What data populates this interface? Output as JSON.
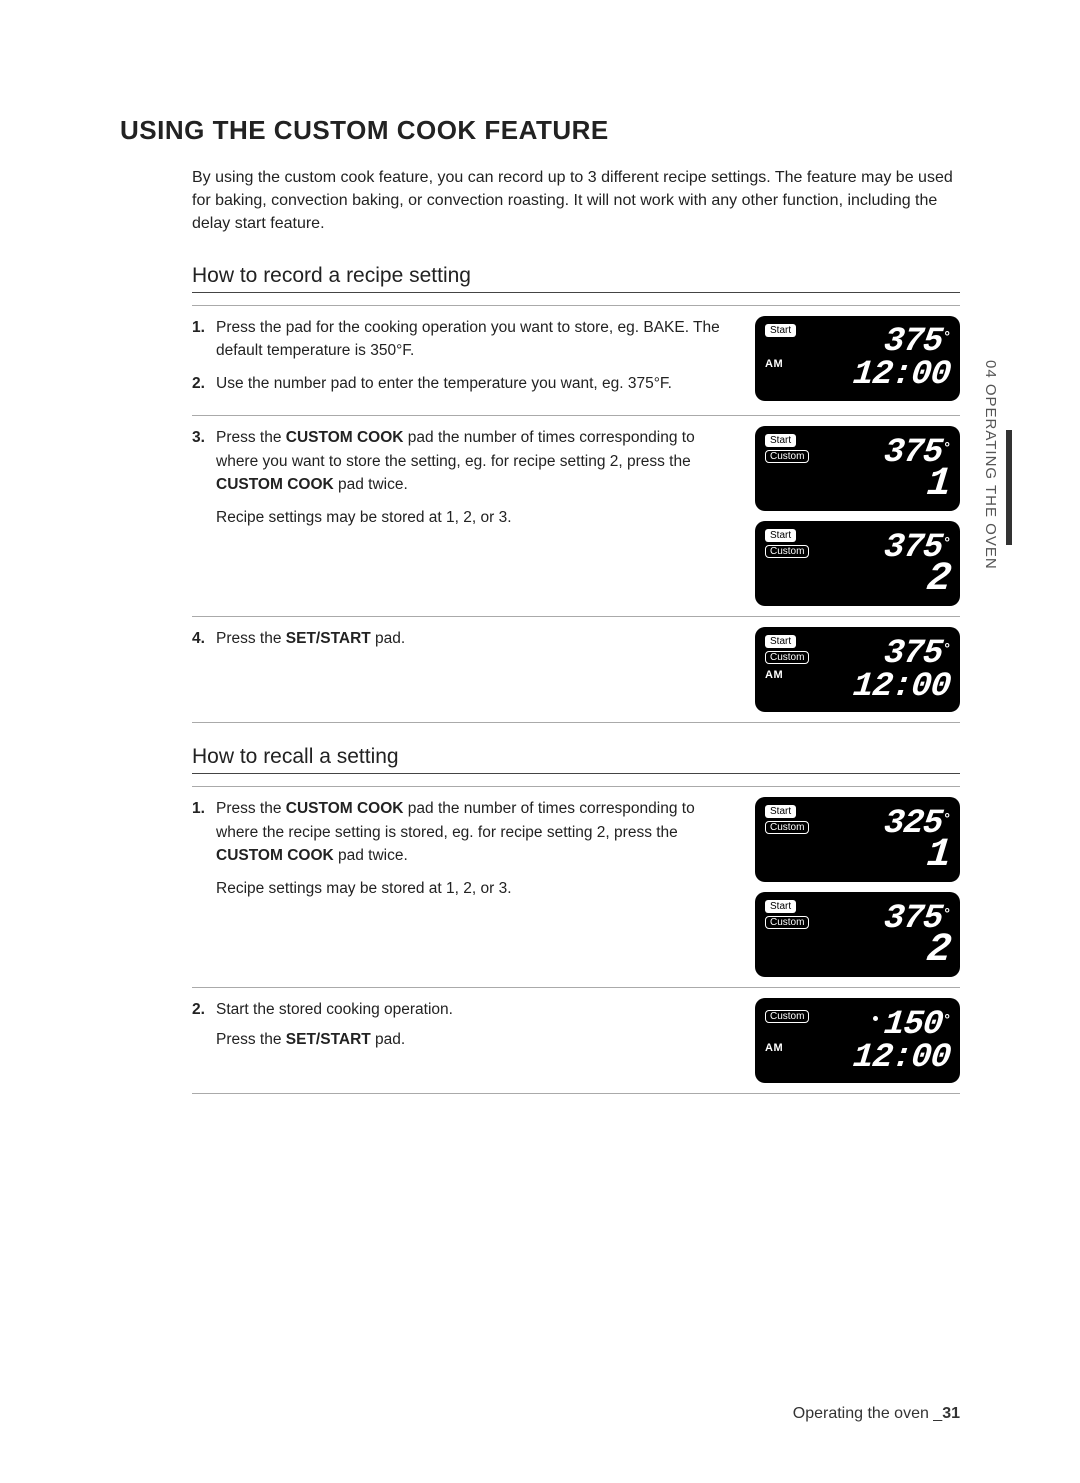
{
  "sidebar": {
    "label": "04  OPERATING THE OVEN"
  },
  "title": "USING THE CUSTOM COOK FEATURE",
  "intro": "By using the custom cook feature, you can record up to 3 different recipe settings. The feature may be used for baking, convection baking, or convection roasting. It will not work with any other function, including the delay start feature.",
  "record": {
    "heading": "How to record a recipe setting",
    "steps": [
      "Press the pad for the cooking operation you want to store, eg. BAKE. The default temperature is 350°F.",
      "Use the number pad to enter the temperature you want, eg. 375°F."
    ],
    "step3_parts": {
      "a": "Press the ",
      "b": "CUSTOM COOK",
      "c": " pad the number of times corresponding to where you want to store the setting, eg. for recipe setting 2, press the ",
      "d": "CUSTOM COOK",
      "e": " pad twice."
    },
    "step3_note": "Recipe settings may be stored at 1, 2, or 3.",
    "step4_parts": {
      "a": "Press the ",
      "b": "SET/START",
      "c": " pad."
    }
  },
  "recall": {
    "heading": "How to recall a setting",
    "step1_parts": {
      "a": "Press the ",
      "b": "CUSTOM COOK",
      "c": " pad the number of times corresponding to where the recipe setting is stored, eg. for recipe setting 2, press the ",
      "d": "CUSTOM COOK",
      "e": " pad twice."
    },
    "step1_note": "Recipe settings may be stored at 1, 2, or 3.",
    "step2_line1": "Start the stored cooking operation.",
    "step2_parts": {
      "a": "Press the ",
      "b": "SET/START",
      "c": " pad."
    }
  },
  "displays": {
    "d1": {
      "start": "Start",
      "am": "AM",
      "temp": "375",
      "deg": "°",
      "clock": "12:00"
    },
    "d2": {
      "start": "Start",
      "custom": "Custom",
      "temp": "375",
      "deg": "°",
      "big": "1"
    },
    "d3": {
      "start": "Start",
      "custom": "Custom",
      "temp": "375",
      "deg": "°",
      "big": "2"
    },
    "d4": {
      "start": "Start",
      "custom": "Custom",
      "am": "AM",
      "temp": "375",
      "deg": "°",
      "clock": "12:00"
    },
    "d5": {
      "start": "Start",
      "custom": "Custom",
      "temp": "325",
      "deg": "°",
      "big": "1"
    },
    "d6": {
      "start": "Start",
      "custom": "Custom",
      "temp": "375",
      "deg": "°",
      "big": "2"
    },
    "d7": {
      "custom": "Custom",
      "am": "AM",
      "temp": "150",
      "deg": "°",
      "clock": "12:00"
    }
  },
  "footer": {
    "label": "Operating the oven _",
    "page": "31"
  }
}
